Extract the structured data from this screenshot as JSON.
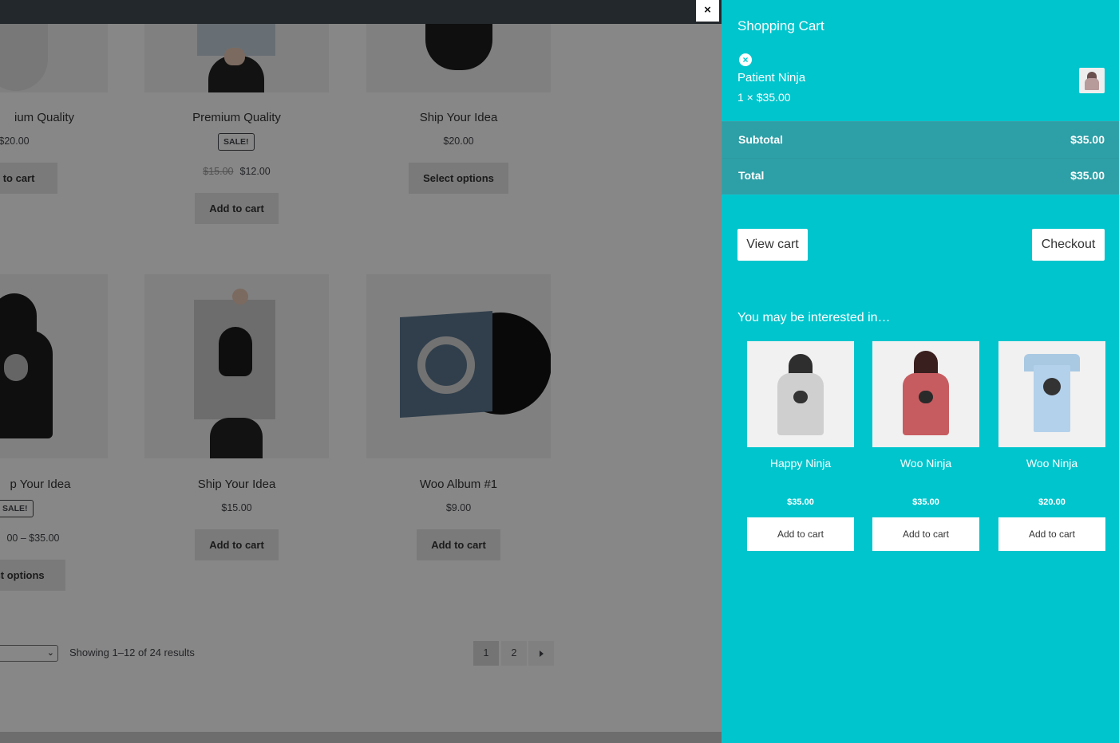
{
  "shop": {
    "products": [
      {
        "title": "ium Quality",
        "price": "$20.00",
        "button": "ld to cart"
      },
      {
        "title": "Premium Quality",
        "sale_badge": "SALE!",
        "old_price": "$15.00",
        "price": "$12.00",
        "button": "Add to cart"
      },
      {
        "title": "Ship Your Idea",
        "price": "$20.00",
        "button": "Select options"
      },
      {
        "title": "p Your Idea",
        "sale_badge": "SALE!",
        "price": "00 – $35.00",
        "button": "ect options"
      },
      {
        "title": "Ship Your Idea",
        "price": "$15.00",
        "button": "Add to cart"
      },
      {
        "title": "Woo Album #1",
        "price": "$9.00",
        "button": "Add to cart"
      }
    ],
    "result_count": "Showing 1–12 of 24 results",
    "pagination": {
      "pages": [
        "1",
        "2"
      ],
      "next_icon": "arrow-right-icon"
    }
  },
  "close_label": "×",
  "cart": {
    "title": "Shopping Cart",
    "item": {
      "remove_icon": "remove-circle-icon",
      "name": "Patient Ninja",
      "qty_price": "1 × $35.00"
    },
    "subtotal_label": "Subtotal",
    "subtotal_value": "$35.00",
    "total_label": "Total",
    "total_value": "$35.00",
    "view_cart": "View cart",
    "checkout": "Checkout",
    "upsell_title": "You may be interested in…",
    "upsells": [
      {
        "name": "Happy Ninja",
        "price": "$35.00",
        "button": "Add to cart"
      },
      {
        "name": "Woo Ninja",
        "price": "$35.00",
        "button": "Add to cart"
      },
      {
        "name": "Woo Ninja",
        "price": "$20.00",
        "button": "Add to cart"
      }
    ]
  },
  "colors": {
    "cart_bg": "#00c5cd",
    "totals_bg": "#2d9fa6",
    "overlay": "rgba(0,0,0,0.47)",
    "topbar": "#23282d"
  }
}
